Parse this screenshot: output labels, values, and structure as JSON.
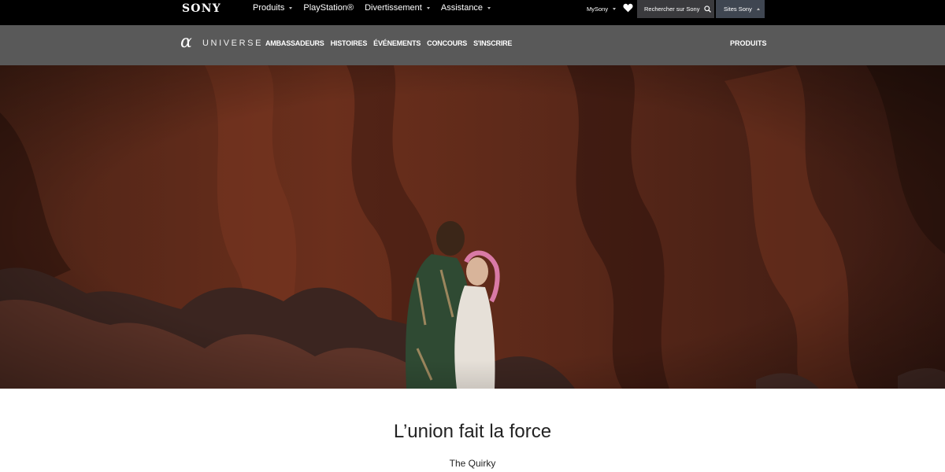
{
  "topbar": {
    "logo": "SONY",
    "nav": [
      {
        "label": "Produits",
        "has_dropdown": true
      },
      {
        "label": "PlayStation®",
        "has_dropdown": false
      },
      {
        "label": "Divertissement",
        "has_dropdown": true
      },
      {
        "label": "Assistance",
        "has_dropdown": true
      }
    ],
    "mysony": "MySony",
    "search_label": "Rechercher sur Sony",
    "sites_label": "Sites Sony",
    "icons": [
      "chevron-down-icon",
      "heart-icon",
      "search-icon",
      "chevron-up-icon"
    ]
  },
  "subbar": {
    "alpha": "α",
    "universe": "UNIVERSE",
    "links": [
      "AMBASSADEURS",
      "HISTOIRES",
      "ÉVÉNEMENTS",
      "CONCOURS",
      "S'INSCRIRE"
    ],
    "products": "PRODUITS"
  },
  "hero": {
    "image": "couple-embracing-red-cliffs-photo"
  },
  "content": {
    "title": "L’union fait la force",
    "author": "The Quirky"
  },
  "colors": {
    "topbar": "#000000",
    "subbar": "#595959",
    "search_box": "#3a3a3d",
    "sites_box": "#3f4651",
    "cliff": "#6b2e1d"
  }
}
